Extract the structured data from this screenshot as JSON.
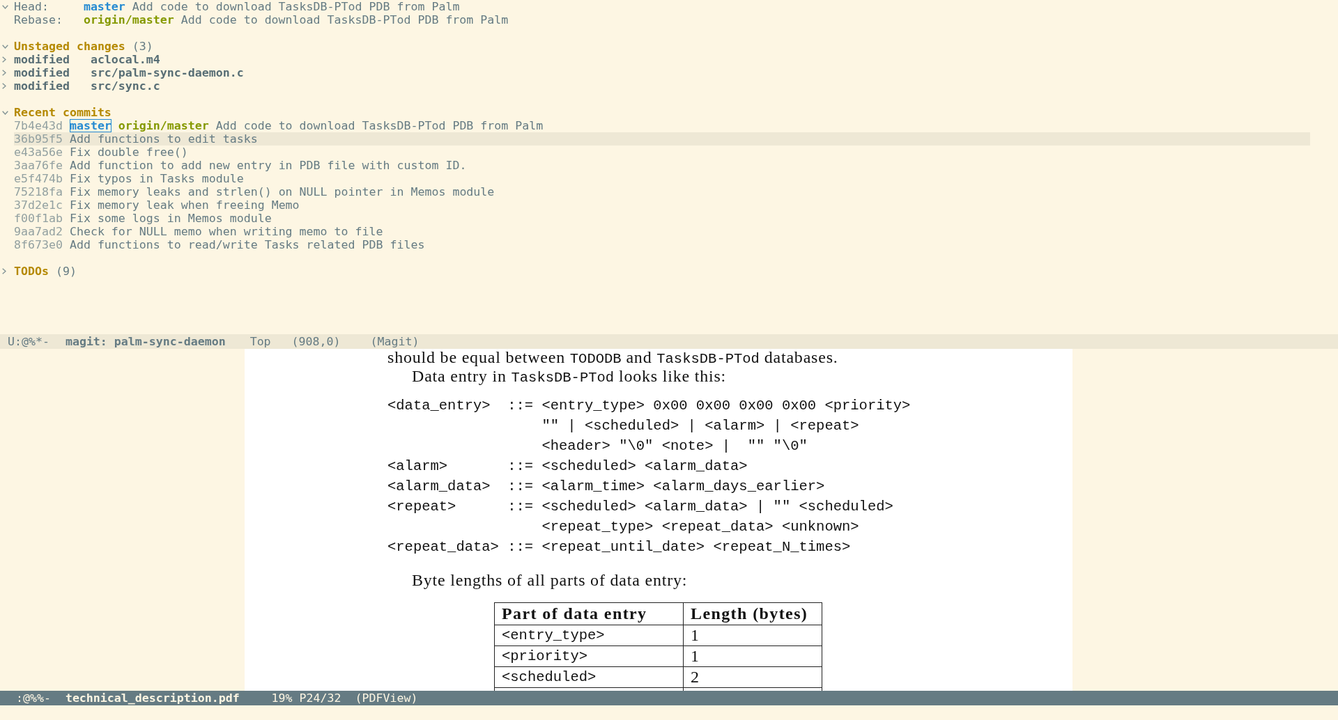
{
  "magit_window": {
    "header": {
      "expanded": true,
      "lines": [
        {
          "label": "Head:",
          "ref": {
            "name": "master",
            "kind": "local"
          },
          "message": "Add code to download TasksDB-PTod PDB from Palm"
        },
        {
          "label": "Rebase:",
          "ref": {
            "name": "origin/master",
            "kind": "remote"
          },
          "message": "Add code to download TasksDB-PTod PDB from Palm"
        }
      ]
    },
    "sections": [
      {
        "kind": "changes",
        "title": "Unstaged changes",
        "count": "(3)",
        "expanded": true,
        "items": [
          {
            "status": "modified",
            "file": "aclocal.m4",
            "expanded": false
          },
          {
            "status": "modified",
            "file": "src/palm-sync-daemon.c",
            "expanded": false
          },
          {
            "status": "modified",
            "file": "src/sync.c",
            "expanded": false
          }
        ]
      },
      {
        "kind": "commits",
        "title": "Recent commits",
        "expanded": true,
        "commits": [
          {
            "hash": "7b4e43d",
            "refs": [
              {
                "name": "master",
                "kind": "local",
                "current": true
              },
              {
                "name": "origin/master",
                "kind": "remote",
                "current": false
              }
            ],
            "message": "Add code to download TasksDB-PTod PDB from Palm",
            "selected": false
          },
          {
            "hash": "36b95f5",
            "message": "Add functions to edit tasks",
            "selected": true
          },
          {
            "hash": "e43a56e",
            "message": "Fix double free()",
            "selected": false
          },
          {
            "hash": "3aa76fe",
            "message": "Add function to add new entry in PDB file with custom ID.",
            "selected": false
          },
          {
            "hash": "e5f474b",
            "message": "Fix typos in Tasks module",
            "selected": false
          },
          {
            "hash": "75218fa",
            "message": "Fix memory leaks and strlen() on NULL pointer in Memos module",
            "selected": false
          },
          {
            "hash": "37d2e1c",
            "message": "Fix memory leak when freeing Memo",
            "selected": false
          },
          {
            "hash": "f00f1ab",
            "message": "Fix some logs in Memos module",
            "selected": false
          },
          {
            "hash": "9aa7ad2",
            "message": "Check for NULL memo when writing memo to file",
            "selected": false
          },
          {
            "hash": "8f673e0",
            "message": "Add functions to read/write Tasks related PDB files",
            "selected": false
          }
        ]
      },
      {
        "kind": "todos",
        "title": "TODOs",
        "count": "(9)",
        "expanded": false
      }
    ],
    "mode_line": {
      "active": false,
      "items": [
        {
          "kind": "status",
          "text": "U:@%*-"
        },
        {
          "kind": "buffer",
          "text": "magit: palm-sync-daemon"
        },
        {
          "kind": "position",
          "text": "Top"
        },
        {
          "kind": "line",
          "text": "(908,0)"
        },
        {
          "kind": "mode",
          "text": "(Magit)"
        }
      ]
    }
  },
  "pdf_window": {
    "page": {
      "blocks": [
        {
          "kind": "paragraph",
          "indented": false,
          "segments": [
            {
              "kind": "text",
              "text": "should be equal between "
            },
            {
              "kind": "code",
              "text": "TODODB"
            },
            {
              "kind": "text",
              "text": " and "
            },
            {
              "kind": "code",
              "text": "TasksDB-PTod"
            },
            {
              "kind": "text",
              "text": " databases."
            }
          ]
        },
        {
          "kind": "paragraph",
          "indented": true,
          "segments": [
            {
              "kind": "text",
              "text": "Data entry in "
            },
            {
              "kind": "code",
              "text": "TasksDB-PTod"
            },
            {
              "kind": "text",
              "text": " looks like this:"
            }
          ]
        },
        {
          "kind": "grammar",
          "rules": [
            {
              "symbol": "<data_entry>",
              "operator": "::=",
              "lines": [
                "<entry_type> 0x00 0x00 0x00 0x00 <priority>",
                "\"\" | <scheduled> | <alarm> | <repeat>",
                "<header> \"\\0\" <note> |  \"\" \"\\0\""
              ]
            },
            {
              "symbol": "<alarm>",
              "operator": "::=",
              "lines": [
                "<scheduled> <alarm_data>"
              ]
            },
            {
              "symbol": "<alarm_data>",
              "operator": "::=",
              "lines": [
                "<alarm_time> <alarm_days_earlier>"
              ]
            },
            {
              "symbol": "<repeat>",
              "operator": "::=",
              "lines": [
                "<scheduled> <alarm_data> | \"\" <scheduled>",
                "<repeat_type> <repeat_data> <unknown>"
              ]
            },
            {
              "symbol": "<repeat_data>",
              "operator": "::=",
              "lines": [
                "<repeat_until_date> <repeat_N_times>"
              ]
            }
          ]
        },
        {
          "kind": "paragraph",
          "indented": true,
          "segments": [
            {
              "kind": "text",
              "text": "Byte lengths of all parts of data entry:"
            }
          ]
        },
        {
          "kind": "table",
          "columns": [
            {
              "label": "Part of data entry",
              "kind": "code"
            },
            {
              "label": "Length (bytes)",
              "kind": "text"
            }
          ],
          "rows": [
            [
              "<entry_type>",
              "1"
            ],
            [
              "<priority>",
              "1"
            ],
            [
              "<scheduled>",
              "2"
            ]
          ]
        }
      ]
    },
    "mode_line": {
      "active": true,
      "items": [
        {
          "kind": "status",
          "text": ":@%%-"
        },
        {
          "kind": "buffer",
          "text": "technical_description.pdf"
        },
        {
          "kind": "position",
          "text": "19% P24/32"
        },
        {
          "kind": "mode",
          "text": "(PDFView)"
        }
      ]
    }
  }
}
